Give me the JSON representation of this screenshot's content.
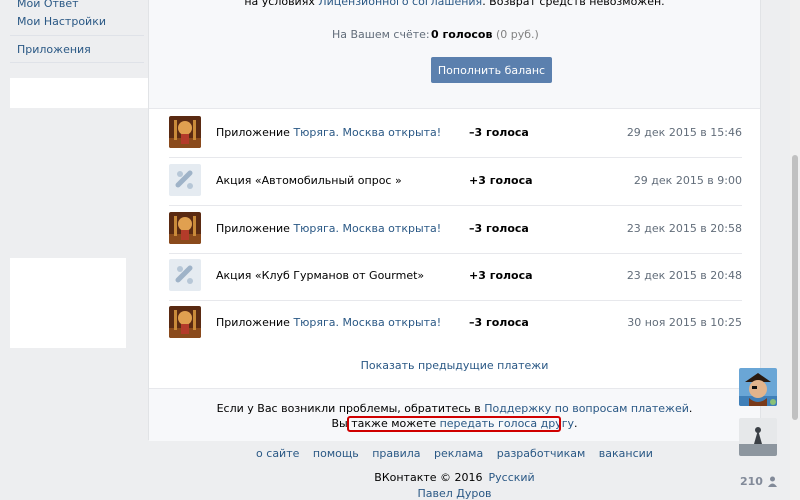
{
  "sidebar": {
    "items": [
      "Мой Ответ",
      "Мои Настройки",
      "Приложения"
    ]
  },
  "terms": {
    "prefix": "на условиях ",
    "link": "Лицензионного соглашения",
    "suffix": ". Возврат средств невозможен."
  },
  "balance": {
    "label": "На Вашем счёте:",
    "votes": "0 голосов",
    "rub": "(0 руб.)",
    "button": "Пополнить баланс"
  },
  "payments": [
    {
      "type": "app",
      "prefix": "Приложение ",
      "name": "Тюряга. Москва открыта!",
      "amount": "–3 голоса",
      "date": "29 дек 2015 в 15:46"
    },
    {
      "type": "promo",
      "prefix": "Акция «Автомобильный опрос »",
      "name": "",
      "amount": "+3 голоса",
      "date": "29 дек 2015 в 9:00"
    },
    {
      "type": "app",
      "prefix": "Приложение ",
      "name": "Тюряга. Москва открыта!",
      "amount": "–3 голоса",
      "date": "23 дек 2015 в 20:58"
    },
    {
      "type": "promo",
      "prefix": "Акция «Клуб Гурманов от Gourmet»",
      "name": "",
      "amount": "+3 голоса",
      "date": "23 дек 2015 в 20:48"
    },
    {
      "type": "app",
      "prefix": "Приложение ",
      "name": "Тюряга. Москва открыта!",
      "amount": "–3 голоса",
      "date": "30 ноя 2015 в 10:25"
    }
  ],
  "show_previous": "Показать предыдущие платежи",
  "support": {
    "text": "Если у Вас возникли проблемы, обратитесь в ",
    "link": "Поддержку по вопросам платежей",
    "end": "."
  },
  "transfer": {
    "text": "Вы также можете ",
    "link": "передать голоса другу",
    "end": "."
  },
  "footer": {
    "links": [
      "о сайте",
      "помощь",
      "правила",
      "реклама",
      "разработчикам",
      "вакансии"
    ],
    "copyright": "ВКонтакте © 2016",
    "language": "Русский",
    "author": "Павел Дуров"
  },
  "chat": {
    "online_count": "210"
  },
  "colors": {
    "link": "#2a5885",
    "button": "#5b80ae",
    "highlight": "#d00000"
  }
}
